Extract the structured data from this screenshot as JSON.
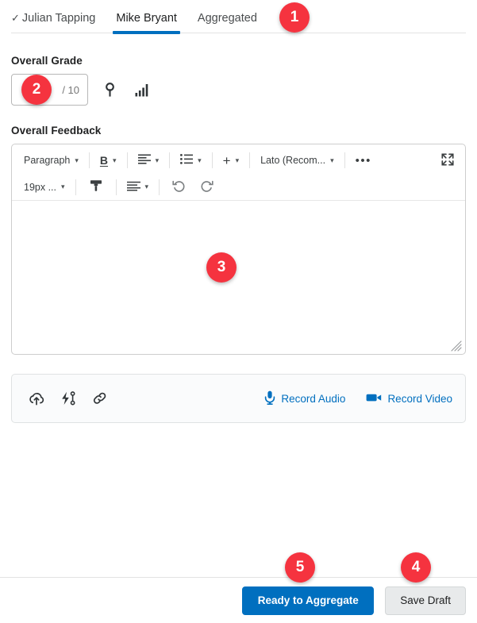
{
  "tabs": [
    {
      "label": "Julian Tapping",
      "checked": true,
      "active": false,
      "check_glyph": "✓"
    },
    {
      "label": "Mike Bryant",
      "checked": false,
      "active": true
    },
    {
      "label": "Aggregated",
      "checked": false,
      "active": false
    }
  ],
  "grade": {
    "label": "Overall Grade",
    "value": "",
    "placeholder": "",
    "denominator": "/ 10",
    "icons": [
      {
        "name": "rubric-key-icon"
      },
      {
        "name": "grade-statistics-icon"
      }
    ]
  },
  "feedback": {
    "label": "Overall Feedback",
    "body_text": "",
    "toolbar_row1": [
      {
        "name": "paragraph-format-select",
        "label": "Paragraph",
        "caret": "∨"
      },
      {
        "name": "bold-button",
        "label": "B",
        "caret": "∨"
      },
      {
        "name": "align-button",
        "label": "",
        "caret": "∨"
      },
      {
        "name": "list-button",
        "label": "",
        "caret": "∨"
      },
      {
        "name": "insert-button",
        "label": "+",
        "caret": "∨"
      },
      {
        "name": "font-family-select",
        "label": "Lato (Recom...",
        "caret": "∨"
      },
      {
        "name": "more-options-button",
        "label": "•••"
      },
      {
        "name": "fullscreen-button",
        "label": ""
      }
    ],
    "toolbar_row2": [
      {
        "name": "font-size-select",
        "label": "19px ...",
        "caret": "∨"
      },
      {
        "name": "format-painter-button",
        "label": ""
      },
      {
        "name": "line-height-button",
        "label": "",
        "caret": "∨"
      },
      {
        "name": "undo-button",
        "label": ""
      },
      {
        "name": "redo-button",
        "label": ""
      }
    ]
  },
  "mediabar": {
    "icons": [
      {
        "name": "upload-cloud-icon"
      },
      {
        "name": "quicklink-icon"
      },
      {
        "name": "insert-link-icon"
      }
    ],
    "record_audio_label": "Record Audio",
    "record_video_label": "Record Video"
  },
  "footer": {
    "primary_label": "Ready to Aggregate",
    "secondary_label": "Save Draft"
  },
  "annotations": [
    {
      "id": "1",
      "target": "tab-row"
    },
    {
      "id": "2",
      "target": "grade-input"
    },
    {
      "id": "3",
      "target": "feedback-editor-body"
    },
    {
      "id": "4",
      "target": "save-draft-button"
    },
    {
      "id": "5",
      "target": "ready-to-aggregate-button"
    }
  ],
  "colors": {
    "accent_blue": "#006fbf",
    "badge_red": "#f5333f",
    "secondary_button": "#e8eaeb"
  }
}
